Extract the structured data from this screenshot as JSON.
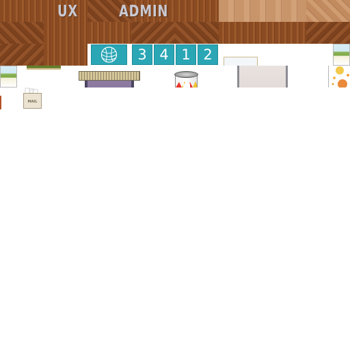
{
  "wall": {
    "left_label": "UX",
    "right_label": "ADMIN"
  },
  "counter": {
    "icon": "yarn-ball-icon",
    "digits": [
      "3",
      "4",
      "1",
      "2"
    ]
  },
  "mailbox": {
    "label": "MAIL"
  },
  "colors": {
    "teal": "#2aa6b5",
    "wood_dark": "#8a4b22",
    "wood_light": "#c8946a"
  }
}
